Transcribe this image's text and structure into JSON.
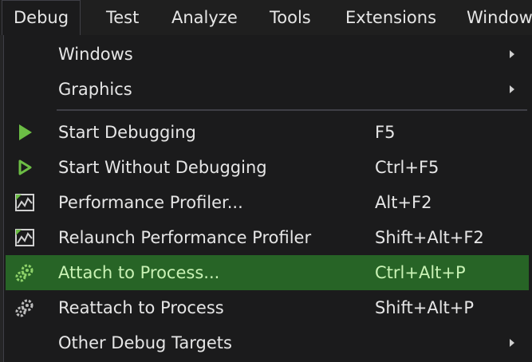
{
  "menubar": {
    "items": [
      "Debug",
      "Test",
      "Analyze",
      "Tools",
      "Extensions",
      "Window"
    ]
  },
  "debug_menu": {
    "items": [
      {
        "label": "Windows",
        "shortcut": "",
        "icon": "",
        "submenu": true,
        "highlighted": false
      },
      {
        "label": "Graphics",
        "shortcut": "",
        "icon": "",
        "submenu": true,
        "highlighted": false
      },
      {
        "label": "Start Debugging",
        "shortcut": "F5",
        "icon": "play-filled-icon",
        "submenu": false,
        "highlighted": false
      },
      {
        "label": "Start Without Debugging",
        "shortcut": "Ctrl+F5",
        "icon": "play-outline-icon",
        "submenu": false,
        "highlighted": false
      },
      {
        "label": "Performance Profiler...",
        "shortcut": "Alt+F2",
        "icon": "performance-chart-icon",
        "submenu": false,
        "highlighted": false
      },
      {
        "label": "Relaunch Performance Profiler",
        "shortcut": "Shift+Alt+F2",
        "icon": "performance-chart-icon",
        "submenu": false,
        "highlighted": false
      },
      {
        "label": "Attach to Process...",
        "shortcut": "Ctrl+Alt+P",
        "icon": "gears-icon",
        "submenu": false,
        "highlighted": true
      },
      {
        "label": "Reattach to Process",
        "shortcut": "Shift+Alt+P",
        "icon": "gears-icon",
        "submenu": false,
        "highlighted": false
      },
      {
        "label": "Other Debug Targets",
        "shortcut": "",
        "icon": "",
        "submenu": true,
        "highlighted": false
      }
    ]
  },
  "colors": {
    "highlight_bg": "#276426",
    "highlight_text": "#c9f2b5",
    "play_green": "#6cbd45",
    "menu_bg": "#1b1b1c",
    "text": "#e6e6e6"
  }
}
